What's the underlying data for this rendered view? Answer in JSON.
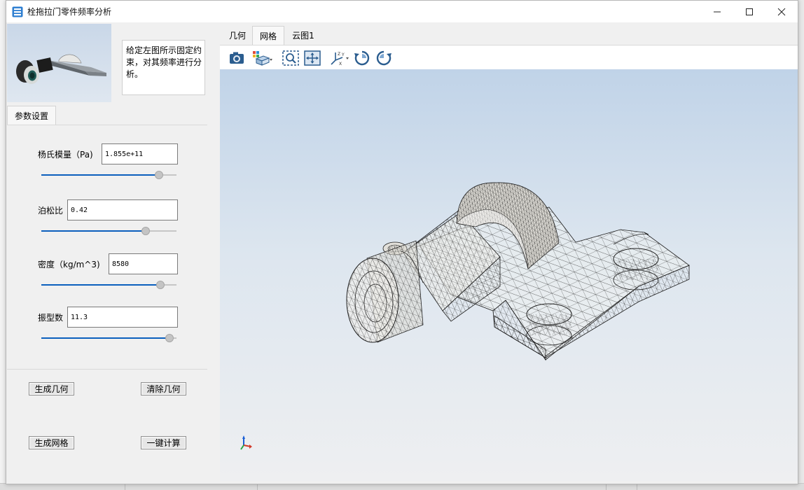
{
  "window": {
    "title": "栓拖拉门零件频率分析"
  },
  "left_panel": {
    "description": "给定左图所示固定约束，对其频率进行分析。",
    "param_tab_label": "参数设置",
    "params": {
      "youngs_label": "杨氏模量（Pa)",
      "youngs_value": "1.855e+11",
      "youngs_level": 0.87,
      "poisson_label": "泊松比",
      "poisson_value": "0.42",
      "poisson_level": 0.77,
      "density_label": "密度（kg/m^3)",
      "density_value": "8580",
      "density_level": 0.88,
      "mode_label": "振型数",
      "mode_value": "11.3",
      "mode_level": 0.95
    },
    "buttons": {
      "gen_geometry": "生成几何",
      "clear_geometry": "清除几何",
      "gen_mesh": "生成网格",
      "one_click_calc": "一键计算"
    }
  },
  "tabs": [
    {
      "label": "几何",
      "active": false
    },
    {
      "label": "网格",
      "active": true
    },
    {
      "label": "云图1",
      "active": false
    }
  ],
  "toolbar_icons": [
    "camera-icon",
    "view-cube-icon",
    "zoom-box-icon",
    "fit-all-icon",
    "axis-orient-icon",
    "rotate-ccw-icon",
    "rotate-cw-icon"
  ],
  "colors": {
    "slider_fill": "#0b5fbd",
    "viewport_top": "#c0d3e8",
    "viewport_bottom": "#eeeff1"
  }
}
